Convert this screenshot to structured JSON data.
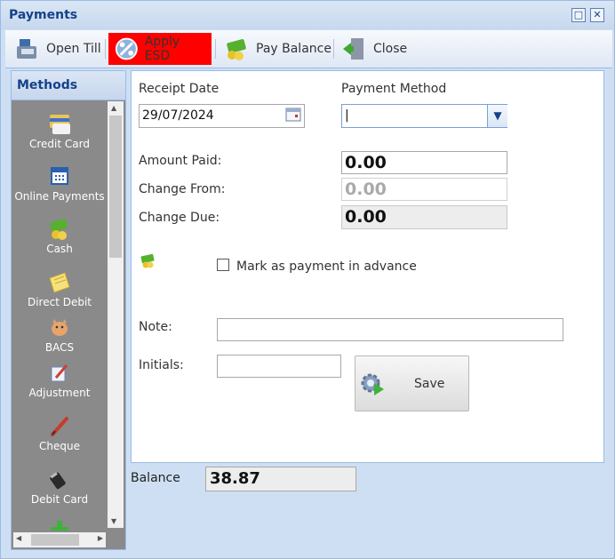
{
  "window": {
    "title": "Payments",
    "min_glyph": "□",
    "close_glyph": "✕"
  },
  "toolbar": {
    "open_till": "Open Till",
    "apply_esd": "Apply ESD",
    "pay_balance": "Pay Balance",
    "close": "Close",
    "active_color": "#ff0000"
  },
  "sidebar": {
    "header": "Methods",
    "items": [
      {
        "label": "Credit Card",
        "icon": "credit-card-icon"
      },
      {
        "label": "Online Payments",
        "icon": "calendar-grid-icon"
      },
      {
        "label": "Cash",
        "icon": "cash-icon"
      },
      {
        "label": "Direct Debit",
        "icon": "note-icon"
      },
      {
        "label": "BACS",
        "icon": "piggy-bank-icon"
      },
      {
        "label": "Adjustment",
        "icon": "adjustment-icon"
      },
      {
        "label": "Cheque",
        "icon": "pen-icon"
      },
      {
        "label": "Debit Card",
        "icon": "card-reader-icon"
      }
    ]
  },
  "form": {
    "receipt_date_label": "Receipt Date",
    "receipt_date_value": "29/07/2024",
    "payment_method_label": "Payment Method",
    "payment_method_value": "|",
    "amount_paid_label": "Amount Paid:",
    "amount_paid_value": "0.00",
    "change_from_label": "Change From:",
    "change_from_value": "0.00",
    "change_due_label": "Change Due:",
    "change_due_value": "0.00",
    "advance_label": "Mark as payment in advance",
    "note_label": "Note:",
    "note_value": "",
    "initials_label": "Initials:",
    "initials_value": "",
    "save_label": "Save"
  },
  "balance": {
    "label": "Balance",
    "value": "38.87"
  }
}
